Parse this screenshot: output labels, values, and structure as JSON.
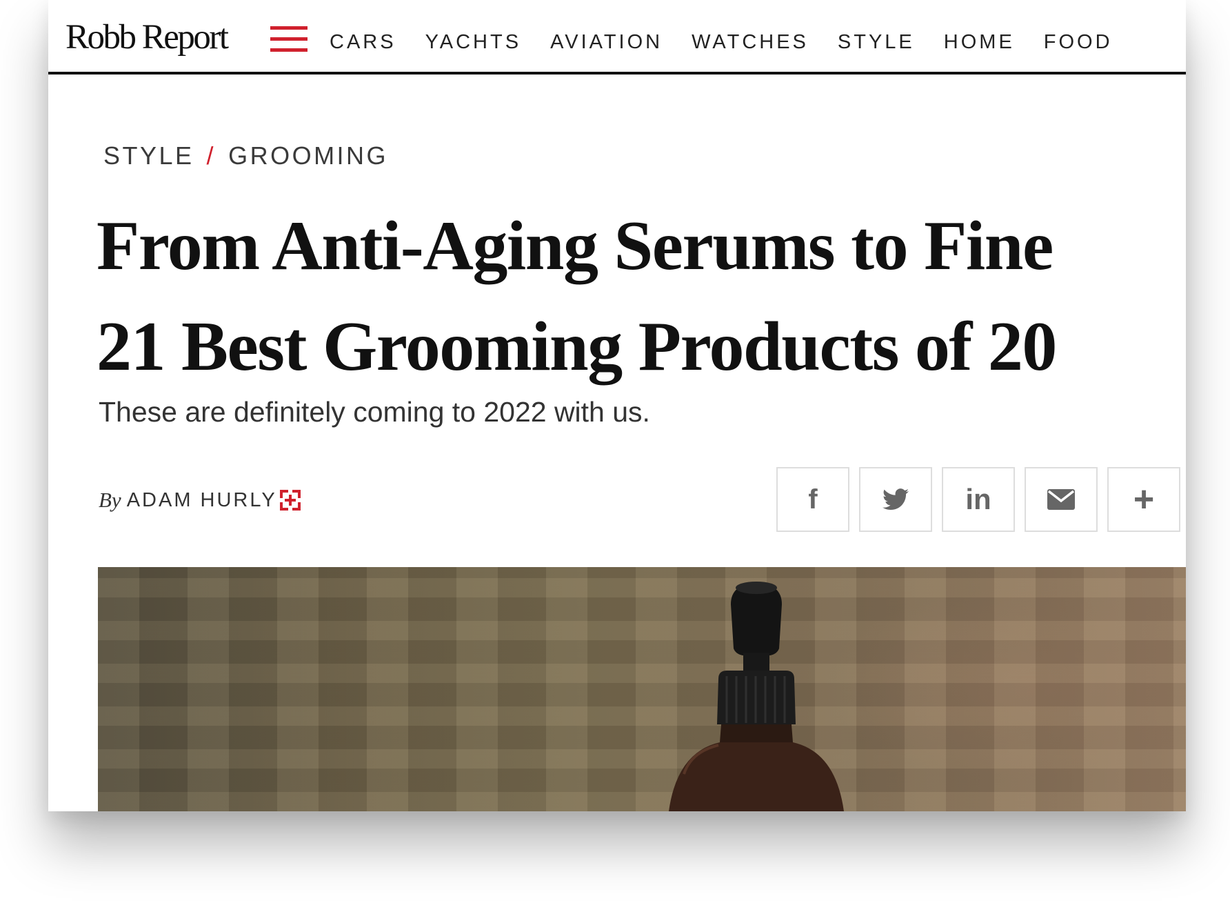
{
  "site": {
    "logo_text": "Robb Report"
  },
  "nav": {
    "menu_icon": "hamburger-menu-icon",
    "links": [
      "CARS",
      "YACHTS",
      "AVIATION",
      "WATCHES",
      "STYLE",
      "HOME",
      "FOOD"
    ]
  },
  "breadcrumb": {
    "section": "STYLE",
    "separator": "/",
    "subsection": "GROOMING"
  },
  "article": {
    "headline_line1": "From Anti-Aging Serums to Fine",
    "headline_line2": "21 Best Grooming Products of 20",
    "dek": "These are definitely coming to 2022 with us.",
    "byline_prefix": "By",
    "author": "ADAM HURLY",
    "hero_image_subject": "dropper bottle"
  },
  "share": {
    "buttons": [
      {
        "name": "facebook",
        "icon": "facebook-icon",
        "glyph": "f"
      },
      {
        "name": "twitter",
        "icon": "twitter-icon",
        "glyph": ""
      },
      {
        "name": "linkedin",
        "icon": "linkedin-icon",
        "glyph": "in"
      },
      {
        "name": "email",
        "icon": "email-icon",
        "glyph": ""
      },
      {
        "name": "more",
        "icon": "plus-icon",
        "glyph": "+"
      }
    ]
  },
  "colors": {
    "accent_red": "#d0212d",
    "text_dark": "#111111",
    "icon_gray": "#666666",
    "border_gray": "#dddddd"
  }
}
